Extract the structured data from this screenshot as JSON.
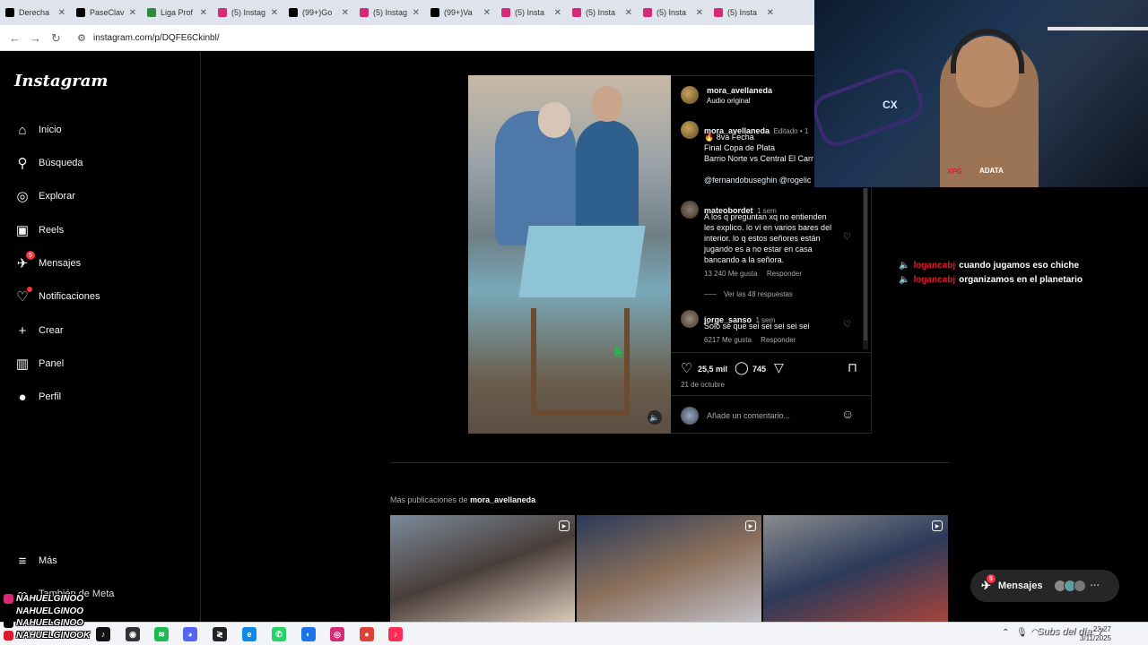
{
  "browser": {
    "tabs": [
      {
        "title": "Derecha",
        "color": "#000000",
        "icon": "x-icon"
      },
      {
        "title": "PaseClav",
        "color": "#000000",
        "icon": "x-icon"
      },
      {
        "title": "Liga Prof",
        "color": "#2e8b3a",
        "icon": "globe-icon"
      },
      {
        "title": "(5) Instag",
        "color": "#d62976",
        "icon": "instagram-icon"
      },
      {
        "title": "(99+)Go",
        "color": "#000000",
        "icon": "tiktok-icon"
      },
      {
        "title": "(5) Instag",
        "color": "#d62976",
        "icon": "instagram-icon"
      },
      {
        "title": "(99+)Va",
        "color": "#000000",
        "icon": "tiktok-icon"
      },
      {
        "title": "(5) Insta",
        "color": "#d62976",
        "icon": "instagram-icon"
      },
      {
        "title": "(5) Insta",
        "color": "#d62976",
        "icon": "instagram-icon"
      },
      {
        "title": "(5) Insta",
        "color": "#d62976",
        "icon": "instagram-icon"
      },
      {
        "title": "(5) Insta",
        "color": "#d62976",
        "icon": "instagram-icon"
      }
    ],
    "url": "instagram.com/p/DQFE6Ckinbl/"
  },
  "sidebar": {
    "logo": "Instagram",
    "items": [
      {
        "label": "Inicio",
        "icon": "home-icon",
        "glyph": "⌂"
      },
      {
        "label": "Búsqueda",
        "icon": "search-icon",
        "glyph": "⚲"
      },
      {
        "label": "Explorar",
        "icon": "compass-icon",
        "glyph": "◎"
      },
      {
        "label": "Reels",
        "icon": "reels-icon",
        "glyph": "▣"
      },
      {
        "label": "Mensajes",
        "icon": "messenger-icon",
        "glyph": "✈",
        "badge": "5"
      },
      {
        "label": "Notificaciones",
        "icon": "heart-icon",
        "glyph": "♡",
        "dot": true
      },
      {
        "label": "Crear",
        "icon": "plus-icon",
        "glyph": "+"
      },
      {
        "label": "Panel",
        "icon": "chart-icon",
        "glyph": "▥"
      },
      {
        "label": "Perfil",
        "icon": "avatar-icon",
        "glyph": "●"
      }
    ],
    "more": "Más",
    "meta": "También de Meta"
  },
  "post": {
    "author": "mora_avellaneda",
    "audio": "Audio original",
    "caption_author": "mora_avellaneda",
    "caption_meta": "Editado • 1",
    "caption_lines": [
      "🔥 8va Fecha",
      "Final Copa de Plata",
      "Barrio Norte vs Central El Carr"
    ],
    "caption_mentions": "@fernandobuseghin @rogelic",
    "comments": [
      {
        "user": "mateobordet",
        "time": "1 sem",
        "text": [
          "A los q preguntan xq no entienden",
          "les explico. lo ví en varios bares del",
          "interior. lo q estos señores están",
          "jugando es a no estar en casa",
          "bancando a la señora."
        ],
        "likes": "13 240 Me gusta",
        "reply": "Responder",
        "replies": "Ver las 48 respuestas"
      },
      {
        "user": "jorge_sanso",
        "time": "1 sem",
        "text": [
          "Solo sé que sei sei sei sei sei"
        ],
        "likes": "6217 Me gusta",
        "reply": "Responder"
      }
    ],
    "like_count": "25,5 mil",
    "comment_count": "745",
    "date": "21 de octubre",
    "comment_placeholder": "Añade un comentario..."
  },
  "more": {
    "prefix": "Más publicaciones de",
    "author": "mora_avellaneda"
  },
  "chat": [
    {
      "user": "logancabj",
      "msg": "cuando jugamos eso chiche"
    },
    {
      "user": "logancabj",
      "msg": "organizamos en el planetario"
    }
  ],
  "messages_pill": {
    "label": "Mensajes",
    "badge": "5"
  },
  "webcam": {
    "cx": "CX",
    "brand1": "XPG",
    "brand2": "ADATA"
  },
  "socials": [
    {
      "handle": "NAHUELGINOO",
      "icon": "instagram-icon",
      "color": "#d62976"
    },
    {
      "handle": "NAHUELGINOO",
      "icon": "tiktok-icon",
      "color": "#000000"
    },
    {
      "handle": "NAHUELGINOO",
      "icon": "x-icon",
      "color": "#000000"
    },
    {
      "handle": "NAHUELGINOOK",
      "icon": "youtube-icon",
      "color": "#e0182c"
    }
  ],
  "overlay_text": "Subs del día: 7",
  "clock": {
    "time": "23:27",
    "date": "3/11/2025"
  },
  "taskbar": [
    {
      "icon": "tiktok-app-icon",
      "color": "#111111",
      "glyph": "♪"
    },
    {
      "icon": "obs-icon",
      "color": "#333333",
      "glyph": "◉"
    },
    {
      "icon": "spotify-icon",
      "color": "#1db954",
      "glyph": "≋"
    },
    {
      "icon": "discord-icon",
      "color": "#5865f2",
      "glyph": "◕"
    },
    {
      "icon": "app-icon",
      "color": "#222222",
      "glyph": "≷"
    },
    {
      "icon": "edge-icon",
      "color": "#0c8ce9",
      "glyph": "e"
    },
    {
      "icon": "whatsapp-icon",
      "color": "#25d366",
      "glyph": "✆"
    },
    {
      "icon": "app2-icon",
      "color": "#1a73e8",
      "glyph": "◐"
    },
    {
      "icon": "instagram-app-icon",
      "color": "#d62976",
      "glyph": "◎"
    },
    {
      "icon": "chrome-icon",
      "color": "#db4437",
      "glyph": "●"
    },
    {
      "icon": "tiktok-live-icon",
      "color": "#fe2c55",
      "glyph": "♪"
    }
  ]
}
